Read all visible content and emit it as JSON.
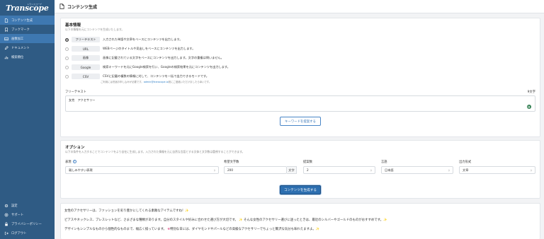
{
  "app": {
    "logo": "Transcope",
    "logo_sub": "トランスコープ"
  },
  "sidebar": {
    "items": [
      {
        "label": "コンテンツ生成",
        "icon": "document-icon",
        "active": true
      },
      {
        "label": "ブックマーク",
        "icon": "bookmark-icon",
        "active": false
      },
      {
        "label": "画像加工",
        "icon": "image-icon",
        "active": true
      },
      {
        "label": "ドキュメント",
        "icon": "pen-icon",
        "active": false
      },
      {
        "label": "検索順位",
        "icon": "ranking-icon",
        "active": false
      }
    ],
    "bottom": [
      {
        "label": "設定",
        "icon": "gear-icon"
      },
      {
        "label": "サポート",
        "icon": "support-icon"
      },
      {
        "label": "プライバシーポリシー",
        "icon": "lock-icon"
      },
      {
        "label": "ログアウト",
        "icon": "logout-icon"
      }
    ]
  },
  "header": {
    "title": "コンテンツ生成"
  },
  "basic": {
    "title": "基本情報",
    "subtitle": "以下の情報を元にコンテンツを生成いたします。",
    "options": [
      {
        "tag": "フリーテキスト",
        "desc": "入力された単語や文章をベースにコンテンツを出力します。",
        "selected": true
      },
      {
        "tag": "URL",
        "desc": "WEBページのタイトルや見出しをベースにコンテンツを出力します。",
        "selected": false
      },
      {
        "tag": "画像",
        "desc": "画像に記載されている文字をベースにコンテンツを出力します。文字の重複は問いません。",
        "selected": false
      },
      {
        "tag": "Google",
        "desc": "検索キーワードを元にGoogle検索を行い、Googleの検索結果を元にコンテンツを出力します。",
        "selected": false
      },
      {
        "tag": "CSV",
        "desc": "CSVに記載の複数の情報に対して、コンテンツを一括で出力できるモードです。",
        "selected": false
      }
    ],
    "csv_note_pre": "ご利用には別途お申し込みが必要です。",
    "csv_note_mail": "admin@transcope.io",
    "csv_note_post": "宛にご連絡いただけましたら幸いです。",
    "freetext_label": "フリーテキスト",
    "char_count": "9文字",
    "freetext_value": "女性　アクセサリー",
    "keyword_button": "キーワードを提案する"
  },
  "options_section": {
    "title": "オプション",
    "subtitle": "以下の条件を入力することでコンテンツをより自在に生成します。入力された情報を元に自然な言語とする文体と文字数は重視することができます。",
    "tone_label": "表現",
    "tone_value": "親しみやすい表現",
    "chars_label": "希望文字数",
    "chars_value": "200",
    "chars_unit": "文字",
    "count_label": "提案数",
    "count_value": "2",
    "lang_label": "言語",
    "lang_value": "日本語",
    "format_label": "出力形式",
    "format_value": "文章",
    "generate_button": "コンテンツを生成する"
  },
  "output": {
    "line1": "女性のアクセサリーは、ファッションを彩り豊かにしてくれる素敵なアイテムですね！",
    "line2a": "ピアスやネックレス、ブレスレットなど、さまざまな種類があります。自分のスタイルや好みに合わせた選び方が大切です。",
    "line2b": "そんな女性のアクセサリー選びに迷ったときは、最近のシルバーやゴールドのものがおすすめです。",
    "line3a": "デザインもシンプルなものから個性的なものまで、幅広く揃っています。",
    "line3b": "特別な日には、ダイヤモンドやパールなどの高級なアクセサリーでちょっと贅沢な気分も味わえますよ。"
  },
  "colors": {
    "sidebar": "#2f5b84",
    "sidebar_active": "#3e78b1",
    "primary": "#2d6fb0",
    "accent": "#4a86c7"
  }
}
